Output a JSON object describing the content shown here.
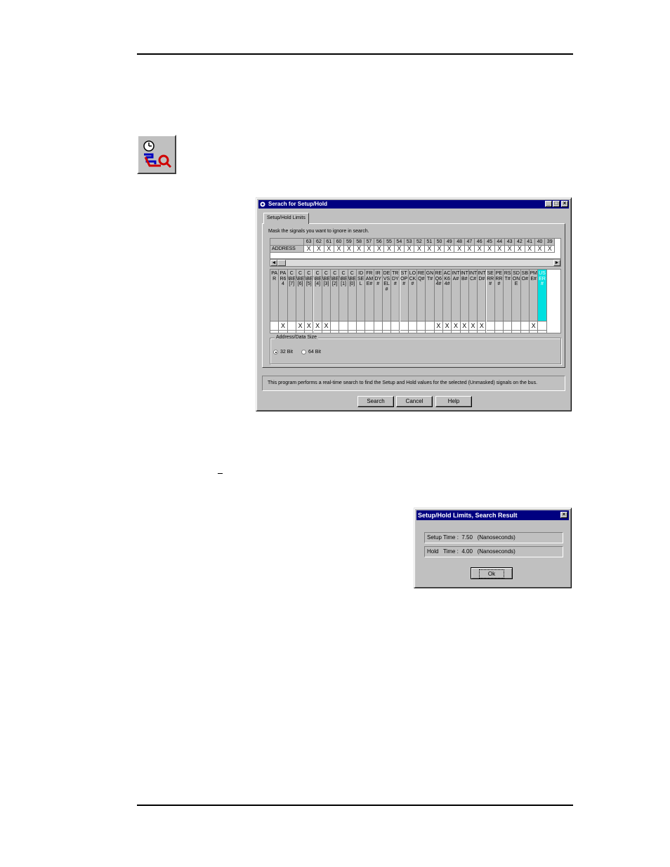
{
  "main_dialog": {
    "title": "Serach for Setup/Hold",
    "tab_label": "Setup/Hold Limits",
    "mask_instruction": "Mask the signals you want to ignore in search.",
    "address_row_label": "ADDRESS",
    "address_columns": [
      "63",
      "62",
      "61",
      "60",
      "59",
      "58",
      "57",
      "56",
      "55",
      "54",
      "53",
      "52",
      "51",
      "50",
      "49",
      "48",
      "47",
      "46",
      "45",
      "44",
      "43",
      "42",
      "41",
      "40",
      "39"
    ],
    "address_values": [
      "X",
      "X",
      "X",
      "X",
      "X",
      "X",
      "X",
      "X",
      "X",
      "X",
      "X",
      "X",
      "X",
      "X",
      "X",
      "X",
      "X",
      "X",
      "X",
      "X",
      "X",
      "X",
      "X",
      "X",
      "X"
    ],
    "signal_columns": [
      {
        "name": "PAR",
        "masked": false
      },
      {
        "name": "PAR64",
        "masked": true
      },
      {
        "name": "C\\BE[7]",
        "masked": false
      },
      {
        "name": "C\\BE[6]",
        "masked": true
      },
      {
        "name": "C\\BE[5]",
        "masked": true
      },
      {
        "name": "C\\BE[4]",
        "masked": true
      },
      {
        "name": "C\\BE[3]",
        "masked": true
      },
      {
        "name": "C\\BE[2]",
        "masked": false
      },
      {
        "name": "C\\BE[1]",
        "masked": false
      },
      {
        "name": "C\\BE[0]",
        "masked": false
      },
      {
        "name": "IDSEL",
        "masked": false
      },
      {
        "name": "FRAME#",
        "masked": false
      },
      {
        "name": "IRDY#",
        "masked": false
      },
      {
        "name": "DEVSEL#",
        "masked": false
      },
      {
        "name": "TRDY#",
        "masked": false
      },
      {
        "name": "STOP#",
        "masked": false
      },
      {
        "name": "LOCK#",
        "masked": false
      },
      {
        "name": "REQ#",
        "masked": false
      },
      {
        "name": "GNT#",
        "masked": false
      },
      {
        "name": "REQ64#",
        "masked": true
      },
      {
        "name": "ACK64#",
        "masked": true
      },
      {
        "name": "INTA#",
        "masked": true
      },
      {
        "name": "INTB#",
        "masked": true
      },
      {
        "name": "INTC#",
        "masked": true
      },
      {
        "name": "INTD#",
        "masked": true
      },
      {
        "name": "SERR#",
        "masked": false
      },
      {
        "name": "PERR#",
        "masked": false
      },
      {
        "name": "RST#",
        "masked": false
      },
      {
        "name": "SDONE",
        "masked": false
      },
      {
        "name": "SBO#",
        "masked": false
      },
      {
        "name": "PME#",
        "masked": true
      },
      {
        "name": "USER#",
        "masked": false,
        "selected": true
      }
    ],
    "mask_symbol": "X",
    "address_data_size": {
      "legend": "Address/Data Size",
      "option_32": "32 Bit",
      "option_64": "64 Bit",
      "selected": "32 Bit"
    },
    "info_text": "This program performs a real-time search to find the Setup and Hold values for the selected (Unmasked) signals on the bus.",
    "buttons": {
      "search": "Search",
      "cancel": "Cancel",
      "help": "Help"
    }
  },
  "result_dialog": {
    "title": "Setup/Hold Limits, Search Result",
    "setup_line": "Setup Time :  7.50   (Nanoseconds)",
    "hold_line": "Hold   Time :  4.00   (Nanoseconds)",
    "ok_label": "Ok"
  },
  "icons": {
    "toolbar_icon": "setup-hold-search-icon",
    "close": "close-icon",
    "minimize": "minimize-icon",
    "maximize": "maximize-icon"
  },
  "colors": {
    "titlebar": "#000080",
    "selected_column": "#00e0e0",
    "window_face": "#c0c0c0"
  }
}
